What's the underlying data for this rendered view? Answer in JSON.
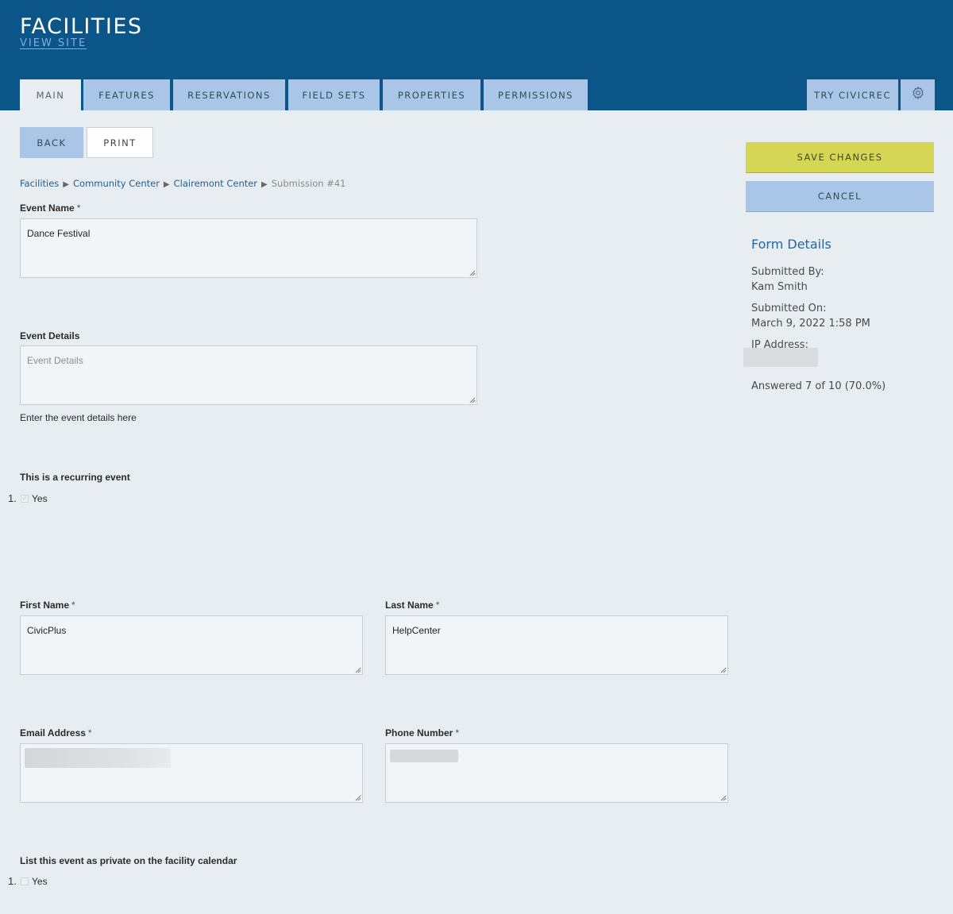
{
  "header": {
    "title": "FACILITIES",
    "view_site": "VIEW SITE",
    "tabs": [
      {
        "label": "MAIN",
        "active": true
      },
      {
        "label": "FEATURES"
      },
      {
        "label": "RESERVATIONS"
      },
      {
        "label": "FIELD SETS"
      },
      {
        "label": "PROPERTIES"
      },
      {
        "label": "PERMISSIONS"
      }
    ],
    "try_label": "TRY CIVICREC",
    "settings_icon": "gear-icon"
  },
  "toolbar": {
    "back_label": "BACK",
    "print_label": "PRINT"
  },
  "breadcrumb": {
    "items": [
      "Facilities",
      "Community Center",
      "Clairemont Center"
    ],
    "current": "Submission #41",
    "separator": "▶"
  },
  "form": {
    "event_name": {
      "label": "Event Name",
      "required": "*",
      "value": "Dance Festival"
    },
    "event_details": {
      "label": "Event Details",
      "placeholder": "Event Details",
      "value": "",
      "helper": "Enter the event details here"
    },
    "recurring": {
      "label": "This is a recurring event",
      "number": "1.",
      "option": "Yes",
      "checked": true
    },
    "first_name": {
      "label": "First Name",
      "required": "*",
      "value": "CivicPlus"
    },
    "last_name": {
      "label": "Last Name",
      "required": "*",
      "value": "HelpCenter"
    },
    "email": {
      "label": "Email Address",
      "required": "*",
      "value": ""
    },
    "phone": {
      "label": "Phone Number",
      "required": "*",
      "value": ""
    },
    "private": {
      "label": "List this event as private on the facility calendar",
      "number": "1.",
      "option": "Yes",
      "checked": false
    }
  },
  "sidebar": {
    "save_label": "SAVE CHANGES",
    "cancel_label": "CANCEL",
    "form_details_title": "Form Details",
    "submitted_by_label": "Submitted By:",
    "submitted_by": "Kam Smith",
    "submitted_on_label": "Submitted On:",
    "submitted_on": "March 9, 2022 1:58 PM",
    "ip_label": "IP Address:",
    "answered": "Answered 7 of 10 (70.0%)"
  },
  "colors": {
    "header_bg": "#0c5588",
    "tab_bg": "#a9c6e6",
    "save_bg": "#d5d653",
    "cancel_bg": "#a9c6e6",
    "page_bg": "#e8edf1"
  }
}
